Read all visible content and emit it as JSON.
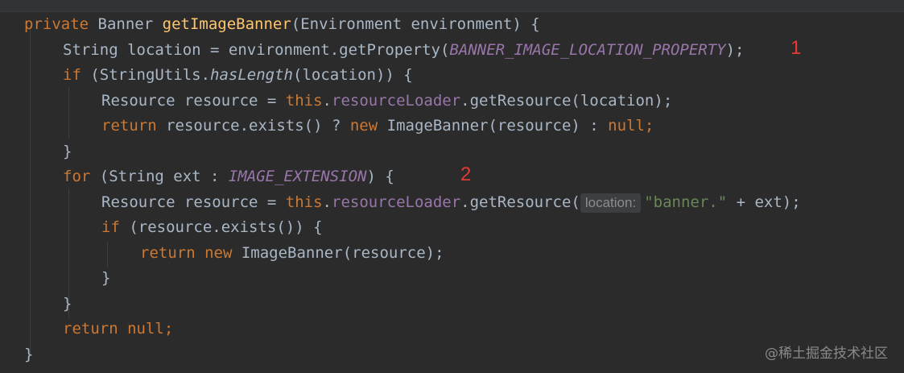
{
  "code": {
    "l1": {
      "private": "private",
      "type": "Banner",
      "method": "getImageBanner",
      "params": "(Environment environment) {"
    },
    "l2": {
      "decl": "String location = environment.getProperty(",
      "const": "BANNER_IMAGE_LOCATION_PROPERTY",
      "close": ");"
    },
    "l3": {
      "if": "if",
      "open": " (StringUtils.",
      "call": "hasLength",
      "rest": "(location)) {"
    },
    "l4": {
      "decl": "Resource resource = ",
      "this": "this",
      ".": ".",
      "field": "resourceLoader",
      "rest": ".getResource(location);"
    },
    "l5": {
      "return": "return",
      "mid": " resource.exists() ? ",
      "new": "new",
      "rest": " ImageBanner(resource) : ",
      "null": "null;"
    },
    "l6": {
      "brace": "}"
    },
    "l7": {
      "for": "for",
      "open": " (String ext : ",
      "const": "IMAGE_EXTENSION",
      "rest": ") {"
    },
    "l8": {
      "decl": "Resource resource = ",
      "this": "this",
      ".": ".",
      "field": "resourceLoader",
      "call": ".getResource(",
      "hint": "location:",
      "str": "\"banner.\"",
      "rest": " + ext);"
    },
    "l9": {
      "if": "if",
      "rest": " (resource.exists()) {"
    },
    "l10": {
      "return": "return",
      "new": "new",
      "rest": " ImageBanner(resource);"
    },
    "l11": {
      "brace": "}"
    },
    "l12": {
      "brace": "}"
    },
    "l13": {
      "return": "return",
      "null": "null;"
    },
    "l14": {
      "brace": "}"
    }
  },
  "annotations": {
    "one": "1",
    "two": "2"
  },
  "watermark": "@稀土掘金技术社区"
}
